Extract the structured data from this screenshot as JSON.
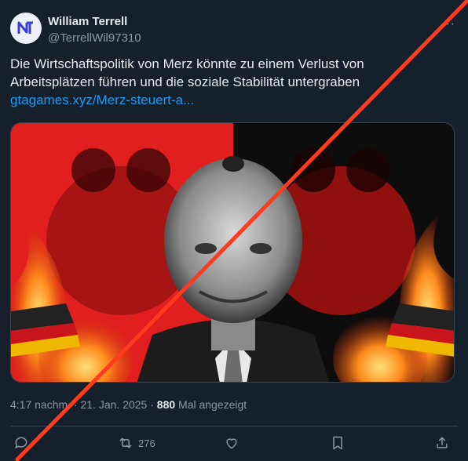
{
  "author": {
    "name": "William Terrell",
    "handle": "@TerrellWil97310",
    "avatar_icon": "avatar-logo-icon"
  },
  "tweet": {
    "text": "Die Wirtschaftspolitik von Merz könnte zu einem Verlust von Arbeitsplätzen führen und die soziale Stabilität untergraben",
    "link": "gtagames.xyz/Merz-steuert-a..."
  },
  "meta": {
    "timestamp": "4:17 nachm. · 21. Jan. 2025 ·",
    "views": "880",
    "views_label": "Mal angezeigt"
  },
  "actions": {
    "retweets": "276"
  },
  "icons": {
    "more": "more-icon",
    "reply": "reply-icon",
    "retweet": "retweet-icon",
    "like": "heart-icon",
    "bookmark": "bookmark-icon",
    "share": "share-icon"
  },
  "colors": {
    "background": "#15202b",
    "text": "#e7e9ea",
    "secondary": "#8b98a5",
    "link": "#1d9bf0",
    "cross": "#ff3b1f"
  }
}
